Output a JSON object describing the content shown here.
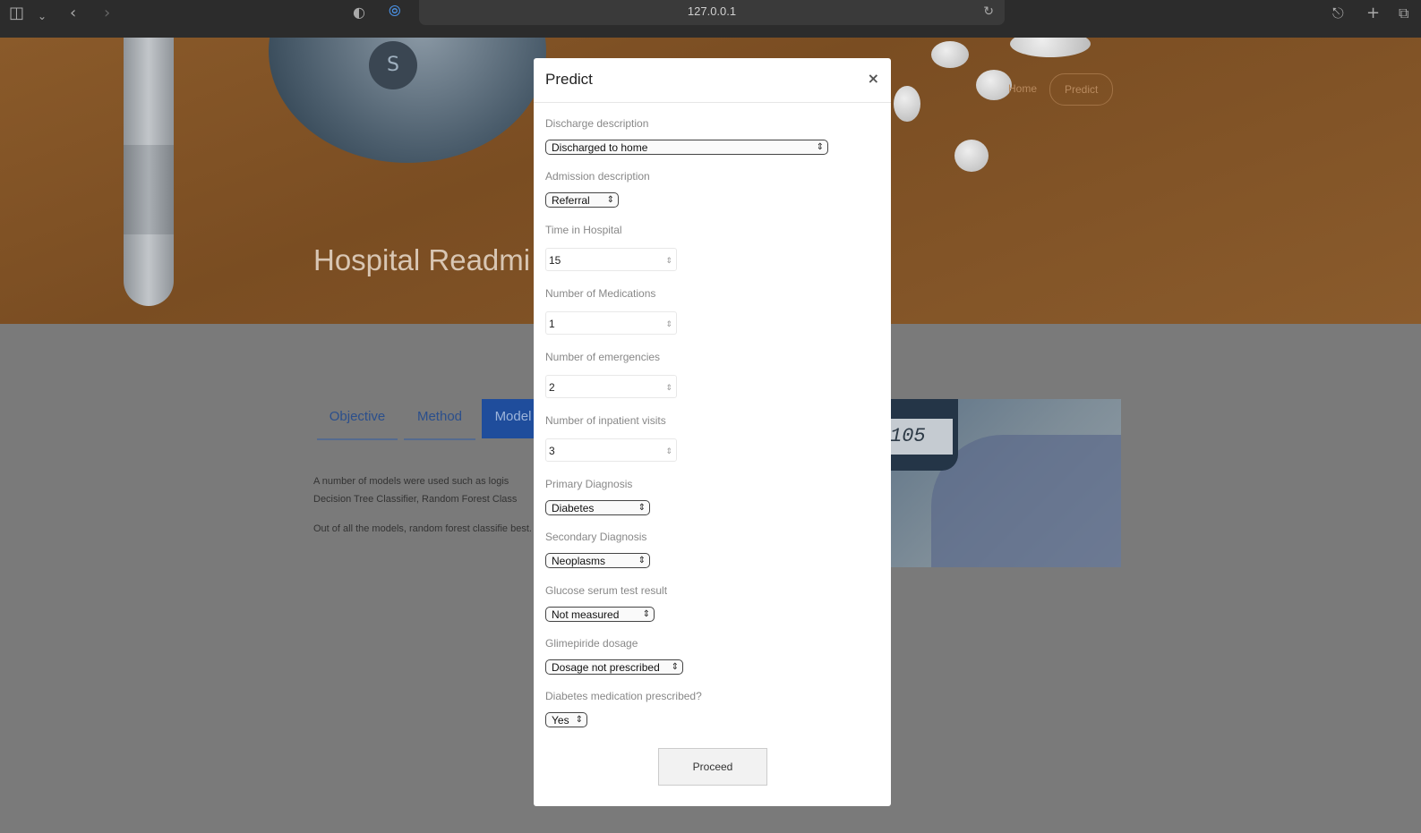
{
  "browser": {
    "url": "127.0.0.1",
    "icons": [
      "sidebar-icon",
      "chevron-down-icon",
      "back-icon",
      "forward-icon",
      "shield-icon",
      "privacy-icon",
      "reload-icon",
      "share-icon",
      "new-tab-icon",
      "tabs-icon"
    ]
  },
  "hero": {
    "title": "Hospital Readmi",
    "breadcrumbs": [
      "Home",
      "Predict"
    ]
  },
  "tabs": [
    "Objective",
    "Method",
    "Model"
  ],
  "content": {
    "para1": "A number of models were used such as logis Decision Tree Classifier, Random Forest Class",
    "para2": "Out of all the models, random forest classifie best.",
    "meter_reading": "105"
  },
  "modal": {
    "title": "Predict",
    "close": "×",
    "fields": {
      "discharge": {
        "label": "Discharge description",
        "value": "Discharged to home"
      },
      "admission": {
        "label": "Admission description",
        "value": "Referral"
      },
      "time_in_hospital": {
        "label": "Time in Hospital",
        "value": "15"
      },
      "num_medications": {
        "label": "Number of Medications",
        "value": "1"
      },
      "num_emergencies": {
        "label": "Number of emergencies",
        "value": "2"
      },
      "num_inpatient": {
        "label": "Number of inpatient visits",
        "value": "3"
      },
      "primary_diag": {
        "label": "Primary Diagnosis",
        "value": "Diabetes"
      },
      "secondary_diag": {
        "label": "Secondary Diagnosis",
        "value": "Neoplasms"
      },
      "glucose": {
        "label": "Glucose serum test result",
        "value": "Not measured"
      },
      "glimepiride": {
        "label": "Glimepiride dosage",
        "value": "Dosage not prescribed"
      },
      "diabetes_med": {
        "label": "Diabetes medication prescribed?",
        "value": "Yes"
      }
    },
    "proceed_label": "Proceed"
  }
}
